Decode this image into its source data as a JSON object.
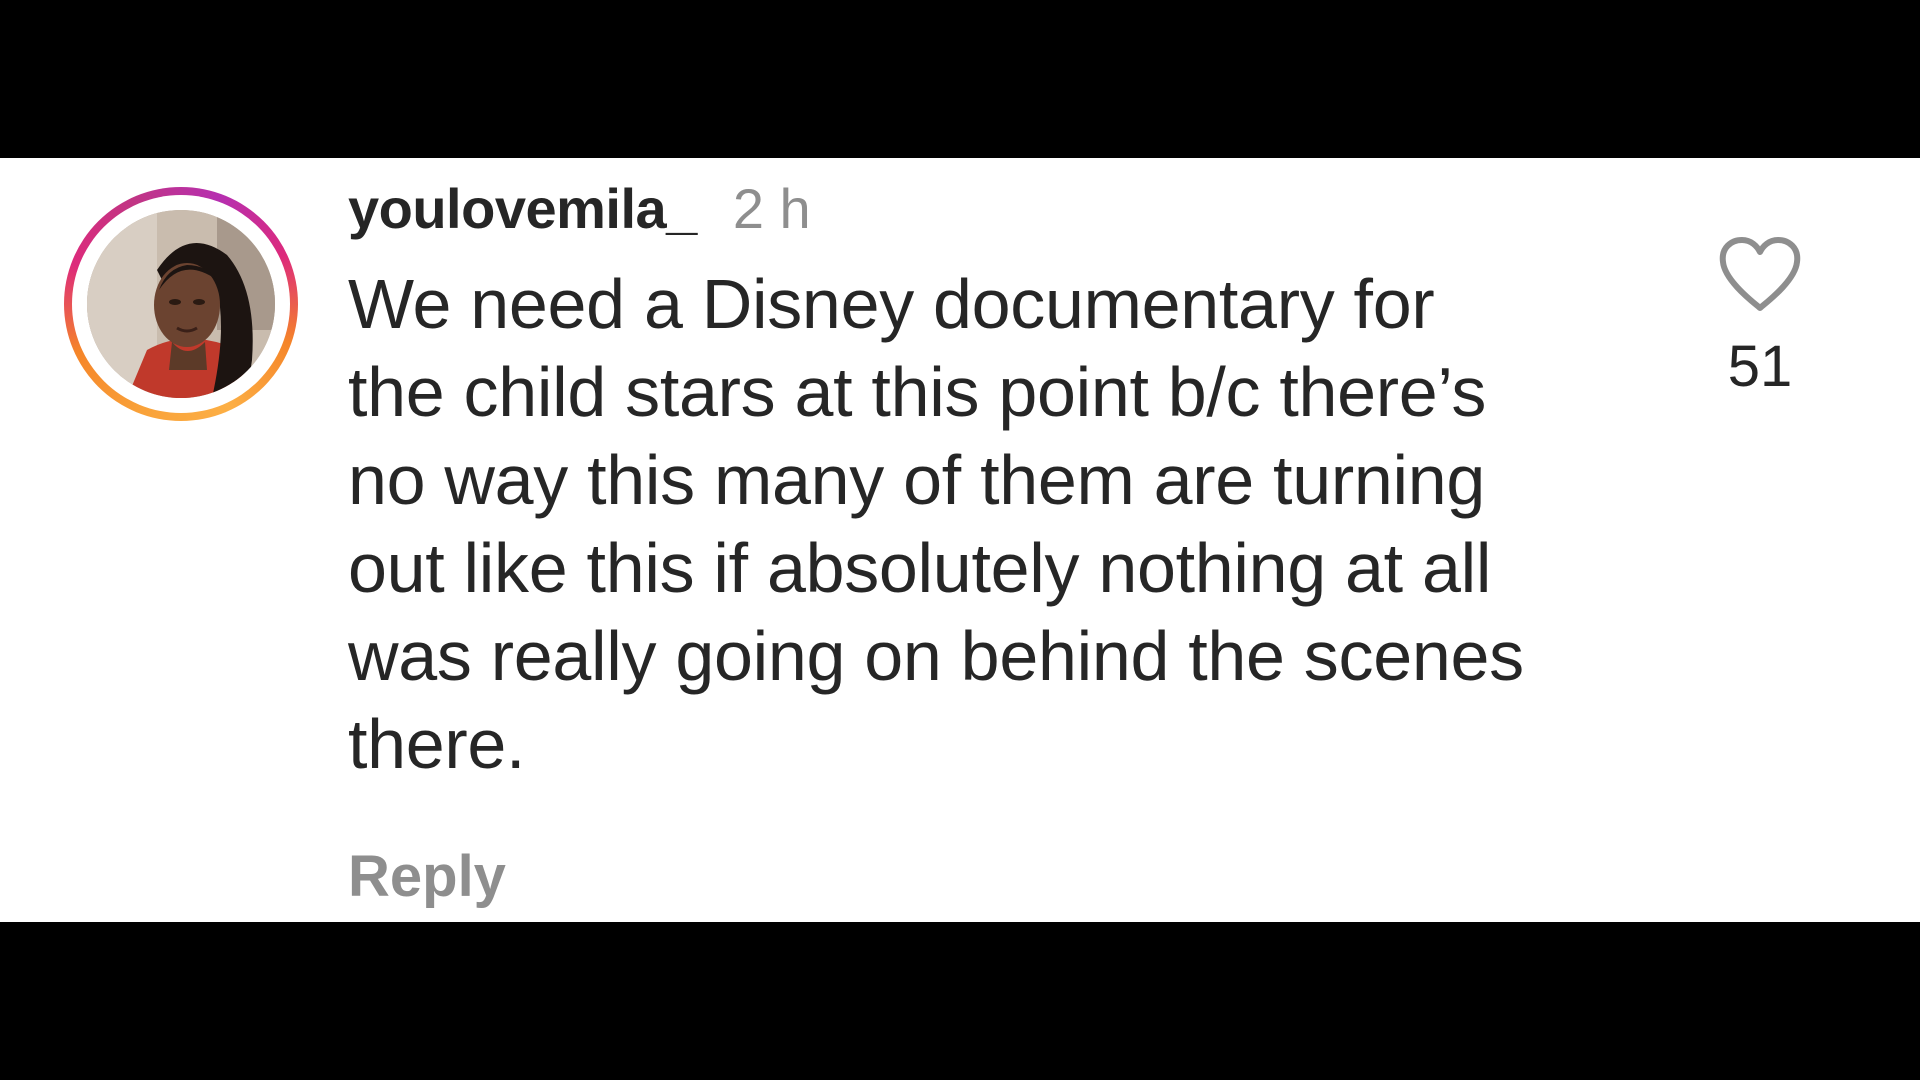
{
  "comment": {
    "username": "youlovemila_",
    "timestamp": "2 h",
    "text_lines": [
      "We need a Disney documentary for",
      "the child stars at this point b/c there’s",
      "no way this many of them are turning",
      "out like this if absolutely nothing at all",
      "was really going on behind the scenes",
      "there."
    ],
    "like_count": "51",
    "reply_label": "Reply"
  },
  "icons": {
    "like": "heart-outline-icon",
    "avatar": "profile-photo-with-story-ring"
  },
  "colors": {
    "background": "#000000",
    "panel": "#ffffff",
    "primary_text": "#262626",
    "secondary_text": "#8e8e8e",
    "story_ring": [
      "#f58529",
      "#dd2a7b",
      "#b62fb0",
      "#fcaf45"
    ]
  }
}
